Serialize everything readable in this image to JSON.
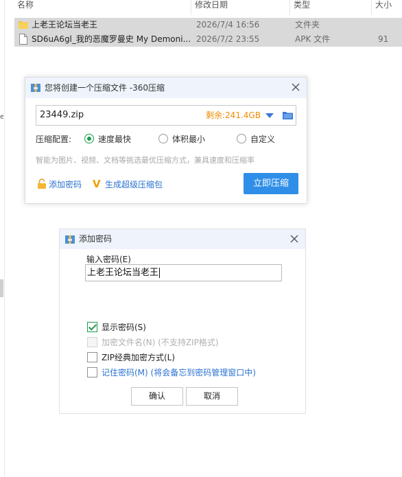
{
  "explorer": {
    "columns": [
      "名称",
      "修改日期",
      "类型",
      "大小"
    ],
    "rows": [
      {
        "name": "上老王论坛当老王",
        "date": "2026/7/4 16:56",
        "type": "文件夹",
        "size": ""
      },
      {
        "name": "SD6uA6gl_我的恶魔罗曼史 My Demoni...",
        "date": "2026/7/2 23:55",
        "type": "APK 文件",
        "size": "91"
      }
    ],
    "left_mark": "e"
  },
  "compress_dialog": {
    "title": "您将创建一个压缩文件 -360压缩",
    "filename": "23449.zip",
    "free_space": "剩余:241.4GB",
    "config_label": "压缩配置:",
    "options": [
      "速度最快",
      "体积最小",
      "自定义"
    ],
    "selected_option": "速度最快",
    "hint": "智能为图片、视频、文档等挑选最优压缩方式，兼具速度和压缩率",
    "add_password": "添加密码",
    "super_pack": "生成超级压缩包",
    "compress_now": "立即压缩"
  },
  "password_dialog": {
    "title": "添加密码",
    "input_label": "输入密码(E)",
    "password_value": "上老王论坛当老王",
    "checkboxes": [
      {
        "label": "显示密码(S)",
        "checked": true,
        "disabled": false
      },
      {
        "label": "加密文件名(N) (不支持ZIP格式)",
        "checked": false,
        "disabled": true
      },
      {
        "label": "ZIP经典加密方式(L)",
        "checked": false,
        "disabled": false
      },
      {
        "label": "记住密码(M) (将会备忘到密码管理窗口中)",
        "checked": false,
        "disabled": false
      }
    ],
    "ok": "确认",
    "cancel": "取消"
  },
  "colors": {
    "accent_blue": "#2e8ee8",
    "free_space_orange": "#f08c00",
    "check_green": "#1a9d4a",
    "selection_gray": "#d9d9d9"
  },
  "icons": [
    "folder-icon",
    "file-icon",
    "archive-icon",
    "close-icon",
    "dropdown-icon",
    "folder-browse-icon",
    "lock-icon",
    "v-icon"
  ]
}
